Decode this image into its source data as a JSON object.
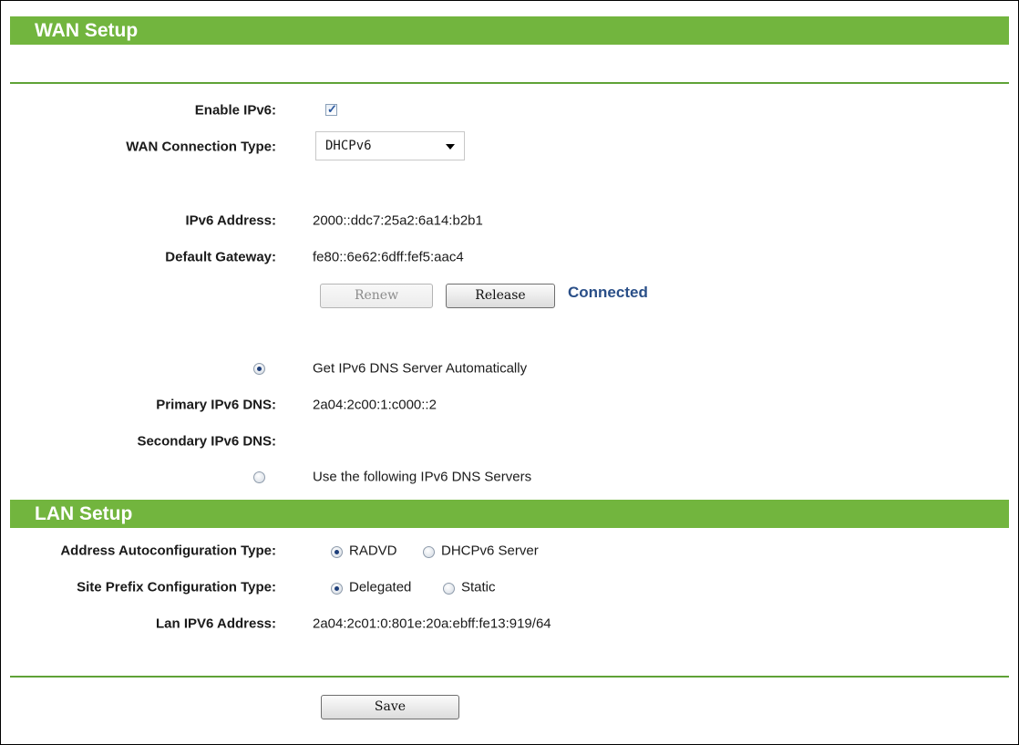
{
  "wan": {
    "title": "WAN Setup",
    "enable_ipv6_label": "Enable IPv6:",
    "enable_ipv6_checked": true,
    "connection_type_label": "WAN Connection Type:",
    "connection_type_value": "DHCPv6",
    "ipv6_address_label": "IPv6 Address:",
    "ipv6_address_value": "2000::ddc7:25a2:6a14:b2b1",
    "default_gateway_label": "Default Gateway:",
    "default_gateway_value": "fe80::6e62:6dff:fef5:aac4",
    "renew_label": "Renew",
    "release_label": "Release",
    "status": "Connected",
    "dns_auto_label": "Get IPv6 DNS Server Automatically",
    "dns_auto_selected": true,
    "primary_dns_label": "Primary IPv6 DNS:",
    "primary_dns_value": "2a04:2c00:1:c000::2",
    "secondary_dns_label": "Secondary IPv6 DNS:",
    "secondary_dns_value": "",
    "dns_manual_label": "Use the following IPv6 DNS Servers",
    "dns_manual_selected": false
  },
  "lan": {
    "title": "LAN Setup",
    "autoconfig_label": "Address Autoconfiguration Type:",
    "autoconfig_options": [
      "RADVD",
      "DHCPv6 Server"
    ],
    "autoconfig_selected": "RADVD",
    "site_prefix_label": "Site Prefix Configuration Type:",
    "site_prefix_options": [
      "Delegated",
      "Static"
    ],
    "site_prefix_selected": "Delegated",
    "lan_address_label": "Lan IPV6 Address:",
    "lan_address_value": "2a04:2c01:0:801e:20a:ebff:fe13:919/64"
  },
  "footer": {
    "save_label": "Save"
  },
  "colors": {
    "banner": "#72b53e",
    "rule": "#5fa237",
    "status": "#2a4f88"
  }
}
